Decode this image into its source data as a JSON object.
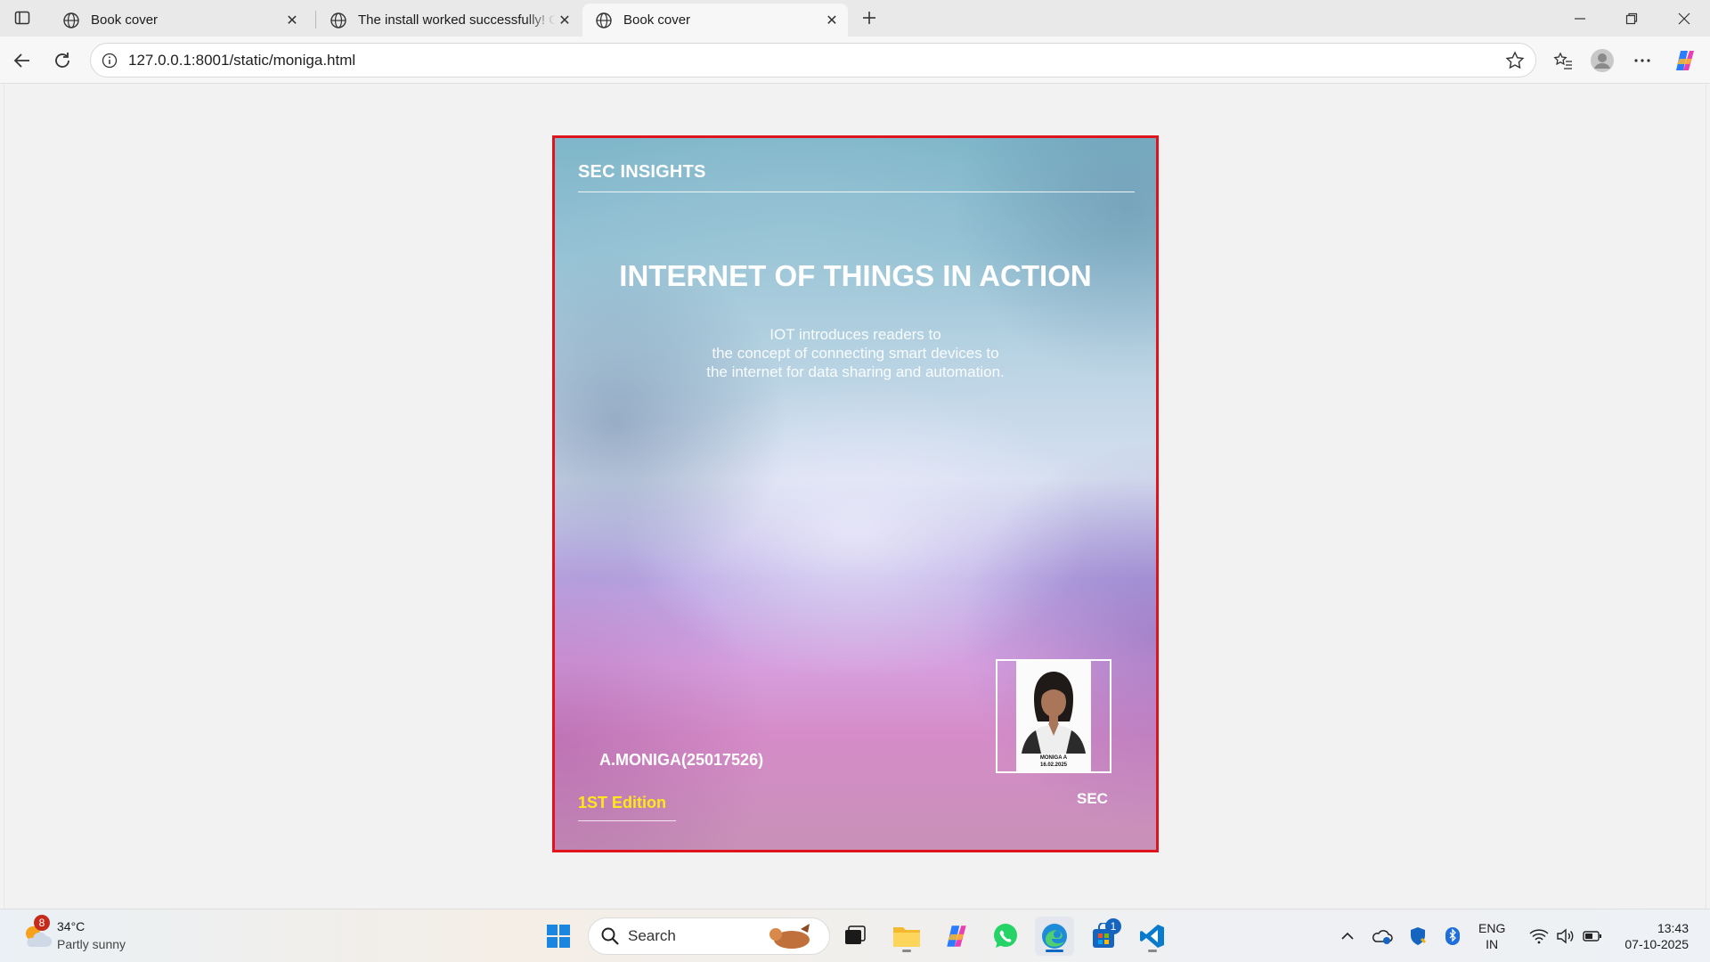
{
  "browser": {
    "tabs": [
      {
        "title": "Book cover",
        "active": false
      },
      {
        "title": "The install worked successfully! Co",
        "active": false
      },
      {
        "title": "Book cover",
        "active": true
      }
    ],
    "address": "127.0.0.1:8001/static/moniga.html"
  },
  "cover": {
    "brand": "SEC INSIGHTS",
    "title": "INTERNET OF THINGS IN ACTION",
    "blurb_lines": [
      "IOT introduces readers to",
      "the concept of connecting smart devices to",
      "the internet for data sharing and automation."
    ],
    "author": "A.MONIGA(25017526)",
    "edition": "1ST Edition",
    "publisher": "SEC",
    "photo_caption_name": "MONIGA A",
    "photo_caption_date": "16.02.2025",
    "colors": {
      "border": "#e0141c",
      "edition": "#ffe81a",
      "text": "#ffffff"
    }
  },
  "taskbar": {
    "weather": {
      "badge": "8",
      "temp": "34°C",
      "desc": "Partly sunny"
    },
    "search_label": "Search",
    "store_badge": "1",
    "lang": [
      "ENG",
      "IN"
    ],
    "time": "13:43",
    "date": "07-10-2025"
  }
}
